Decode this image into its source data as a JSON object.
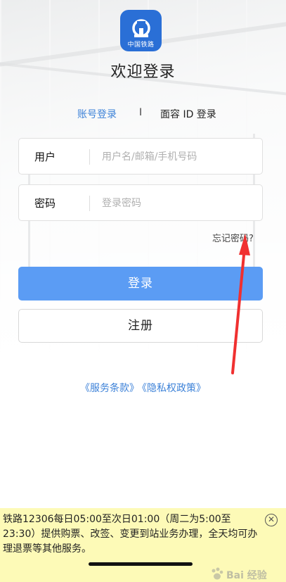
{
  "header": {
    "logo_text": "中国铁路",
    "welcome_title": "欢迎登录"
  },
  "tabs": {
    "account_login": "账号登录",
    "separator": "I",
    "face_id_login": "面容 ID 登录"
  },
  "form": {
    "user_label": "用户",
    "user_placeholder": "用户名/邮箱/手机号码",
    "user_value": "",
    "password_label": "密码",
    "password_placeholder": "登录密码",
    "password_value": "",
    "forgot_password": "忘记密码?"
  },
  "buttons": {
    "login": "登录",
    "register": "注册"
  },
  "links": {
    "terms_of_service": "《服务条款》",
    "privacy_policy": "《隐私权政策》"
  },
  "notice": {
    "text": "铁路12306每日05:00至次日01:00（周二为5:00至23:30）提供购票、改签、变更到站业务办理，全天均可办理退票等其他服务。",
    "close_icon": "close-circle-icon"
  },
  "watermark": {
    "text": "Bai 经验"
  },
  "colors": {
    "accent_blue": "#3d82d8",
    "login_button": "#5b9cf4",
    "logo_bg": "#2a6fd6",
    "notice_bg": "#fdfab7",
    "annotation_arrow": "#f03030"
  }
}
